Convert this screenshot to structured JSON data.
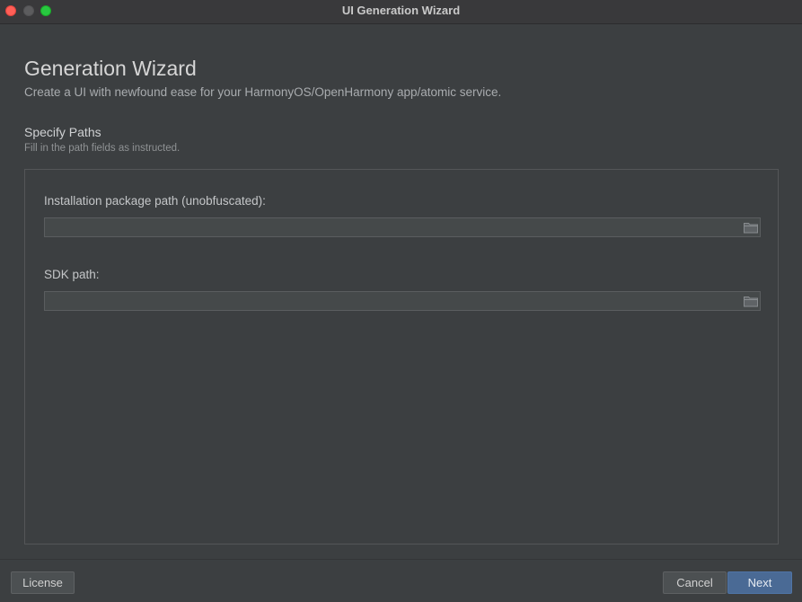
{
  "window": {
    "title": "UI Generation Wizard"
  },
  "wizard": {
    "heading": "Generation Wizard",
    "subheading": "Create a UI with newfound ease for your HarmonyOS/OpenHarmony app/atomic service."
  },
  "section": {
    "title": "Specify Paths",
    "subtitle": "Fill in the path fields as instructed."
  },
  "fields": {
    "package_path": {
      "label": "Installation package path (unobfuscated):",
      "value": "",
      "icon": "folder-icon"
    },
    "sdk_path": {
      "label": "SDK path:",
      "value": "",
      "icon": "folder-icon"
    }
  },
  "footer": {
    "license_label": "License",
    "cancel_label": "Cancel",
    "next_label": "Next"
  },
  "colors": {
    "background": "#3c3f41",
    "accent": "#4a6a95",
    "close": "#ff5f57",
    "maximize": "#28c840"
  }
}
